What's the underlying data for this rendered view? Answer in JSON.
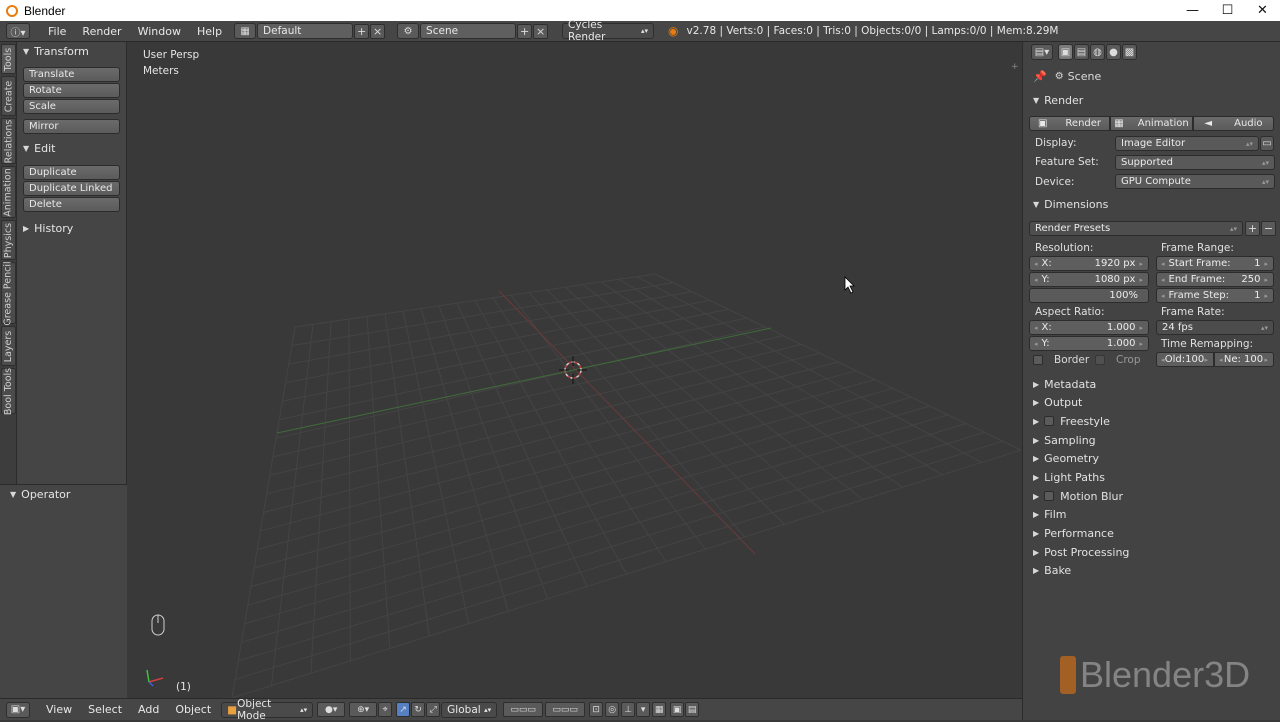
{
  "window": {
    "title": "Blender",
    "minimize": "—",
    "maximize": "☐",
    "close": "✕"
  },
  "info_header": {
    "menus": [
      "File",
      "Render",
      "Window",
      "Help"
    ],
    "screen_layout": "Default",
    "scene": "Scene",
    "render_engine": "Cycles Render",
    "stats": "v2.78 | Verts:0 | Faces:0 | Tris:0 | Objects:0/0 | Lamps:0/0 | Mem:8.29M"
  },
  "tool_tabs": [
    "Tools",
    "Create",
    "Relations",
    "Animation",
    "Physics",
    "Grease Pencil",
    "Layers",
    "Bool Tools"
  ],
  "tool_shelf": {
    "transform_title": "Transform",
    "transform_buttons": [
      "Translate",
      "Rotate",
      "Scale"
    ],
    "mirror": "Mirror",
    "edit_title": "Edit",
    "edit_buttons": [
      "Duplicate",
      "Duplicate Linked",
      "Delete"
    ],
    "history_title": "History",
    "operator_title": "Operator"
  },
  "viewport": {
    "view_name": "User Persp",
    "units": "Meters",
    "frame_indicator": "(1)"
  },
  "properties": {
    "context": "Scene",
    "render_section": "Render",
    "render_buttons": [
      "Render",
      "Animation",
      "Audio"
    ],
    "display_label": "Display:",
    "display_value": "Image Editor",
    "feature_label": "Feature Set:",
    "feature_value": "Supported",
    "device_label": "Device:",
    "device_value": "GPU Compute",
    "dimensions_section": "Dimensions",
    "render_presets": "Render Presets",
    "resolution_label": "Resolution:",
    "res_x_label": "X:",
    "res_x": "1920 px",
    "res_y_label": "Y:",
    "res_y": "1080 px",
    "res_pct": "100%",
    "frame_range_label": "Frame Range:",
    "start_label": "Start Frame:",
    "start_value": "1",
    "end_label": "End Frame:",
    "end_value": "250",
    "step_label": "Frame Step:",
    "step_value": "1",
    "aspect_label": "Aspect Ratio:",
    "aspect_x_label": "X:",
    "aspect_x": "1.000",
    "aspect_y_label": "Y:",
    "aspect_y": "1.000",
    "frame_rate_label": "Frame Rate:",
    "frame_rate": "24 fps",
    "time_remap_label": "Time Remapping:",
    "old_value": "Old:100",
    "new_value": "Ne:  100",
    "border_label": "Border",
    "crop_label": "Crop",
    "sections": [
      "Metadata",
      "Output",
      "Freestyle",
      "Sampling",
      "Geometry",
      "Light Paths",
      "Motion Blur",
      "Film",
      "Performance",
      "Post Processing",
      "Bake"
    ]
  },
  "bottom_header": {
    "menus": [
      "View",
      "Select",
      "Add",
      "Object"
    ],
    "mode": "Object Mode",
    "orientation": "Global"
  },
  "watermark": "Blender3D"
}
